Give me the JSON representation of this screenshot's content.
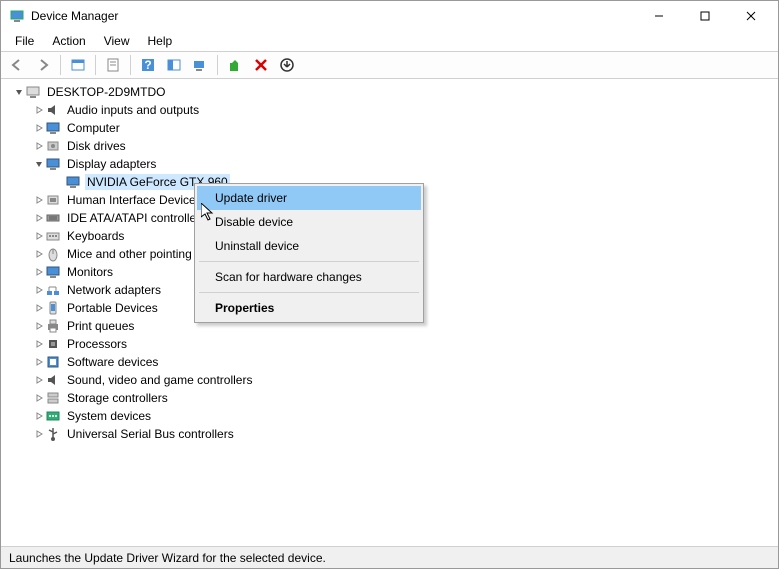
{
  "titlebar": {
    "title": "Device Manager"
  },
  "menubar": {
    "items": [
      "File",
      "Action",
      "View",
      "Help"
    ]
  },
  "toolbar": {
    "buttons": [
      "back",
      "forward",
      "show-hidden",
      "properties",
      "help",
      "toggle",
      "scan",
      "enable",
      "remove",
      "update"
    ]
  },
  "tree": {
    "root": {
      "label": "DESKTOP-2D9MTDO",
      "icon": "computer",
      "expanded": true
    },
    "nodes": [
      {
        "label": "Audio inputs and outputs",
        "icon": "audio",
        "hasChildren": true,
        "expanded": false
      },
      {
        "label": "Computer",
        "icon": "monitor",
        "hasChildren": true,
        "expanded": false
      },
      {
        "label": "Disk drives",
        "icon": "disk",
        "hasChildren": true,
        "expanded": false
      },
      {
        "label": "Display adapters",
        "icon": "monitor",
        "hasChildren": true,
        "expanded": true,
        "children": [
          {
            "label": "NVIDIA GeForce GTX 960",
            "icon": "monitor",
            "selected": true
          }
        ]
      },
      {
        "label": "Human Interface Device",
        "icon": "hid",
        "hasChildren": true,
        "expanded": false
      },
      {
        "label": "IDE ATA/ATAPI controlle",
        "icon": "ide",
        "hasChildren": true,
        "expanded": false
      },
      {
        "label": "Keyboards",
        "icon": "keyboard",
        "hasChildren": true,
        "expanded": false
      },
      {
        "label": "Mice and other pointing",
        "icon": "mouse",
        "hasChildren": true,
        "expanded": false
      },
      {
        "label": "Monitors",
        "icon": "monitor",
        "hasChildren": true,
        "expanded": false
      },
      {
        "label": "Network adapters",
        "icon": "network",
        "hasChildren": true,
        "expanded": false
      },
      {
        "label": "Portable Devices",
        "icon": "portable",
        "hasChildren": true,
        "expanded": false
      },
      {
        "label": "Print queues",
        "icon": "printer",
        "hasChildren": true,
        "expanded": false
      },
      {
        "label": "Processors",
        "icon": "cpu",
        "hasChildren": true,
        "expanded": false
      },
      {
        "label": "Software devices",
        "icon": "software",
        "hasChildren": true,
        "expanded": false
      },
      {
        "label": "Sound, video and game controllers",
        "icon": "audio",
        "hasChildren": true,
        "expanded": false
      },
      {
        "label": "Storage controllers",
        "icon": "storage",
        "hasChildren": true,
        "expanded": false
      },
      {
        "label": "System devices",
        "icon": "system",
        "hasChildren": true,
        "expanded": false
      },
      {
        "label": "Universal Serial Bus controllers",
        "icon": "usb",
        "hasChildren": true,
        "expanded": false
      }
    ]
  },
  "context_menu": {
    "items": [
      {
        "label": "Update driver",
        "highlighted": true
      },
      {
        "label": "Disable device"
      },
      {
        "label": "Uninstall device"
      },
      {
        "sep": true
      },
      {
        "label": "Scan for hardware changes"
      },
      {
        "sep": true
      },
      {
        "label": "Properties",
        "bold": true
      }
    ]
  },
  "statusbar": {
    "text": "Launches the Update Driver Wizard for the selected device."
  }
}
